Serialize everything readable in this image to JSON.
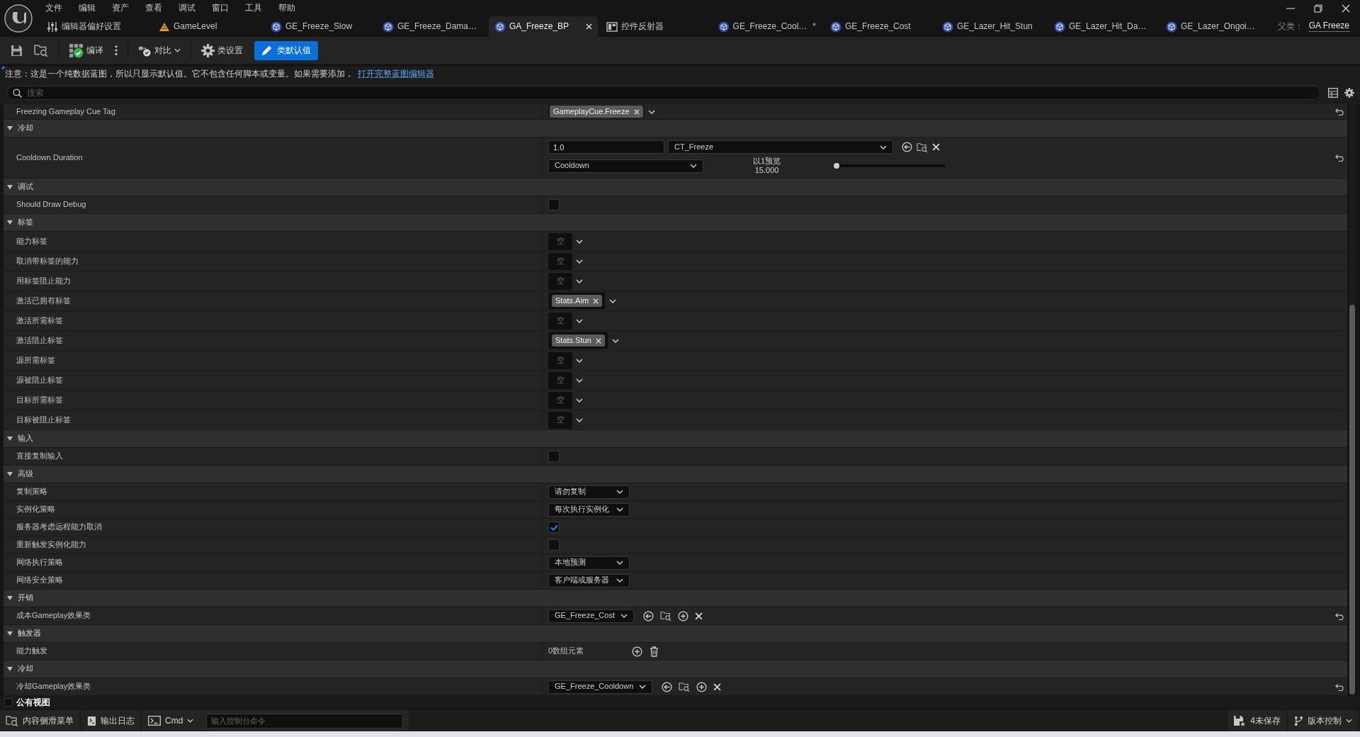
{
  "menu": [
    "文件",
    "编辑",
    "资产",
    "查看",
    "调试",
    "窗口",
    "工具",
    "帮助"
  ],
  "tabs": [
    {
      "kind": "settings",
      "label": "编辑器偏好设置",
      "selected": false
    },
    {
      "kind": "level",
      "label": "GameLevel",
      "selected": false
    },
    {
      "kind": "blueprint",
      "label": "GE_Freeze_Slow",
      "selected": false
    },
    {
      "kind": "blueprint",
      "label": "GE_Freeze_Dama…",
      "selected": false
    },
    {
      "kind": "blueprint",
      "label": "GA_Freeze_BP",
      "selected": true
    },
    {
      "kind": "widget",
      "label": "控件反射器",
      "selected": false
    },
    {
      "kind": "blueprint",
      "label": "GE_Freeze_Cool…",
      "dirty_mark": "*",
      "selected": false
    },
    {
      "kind": "blueprint",
      "label": "GE_Freeze_Cost",
      "selected": false
    },
    {
      "kind": "blueprint",
      "label": "GE_Lazer_Hit_Stun",
      "selected": false
    },
    {
      "kind": "blueprint",
      "label": "GE_Lazer_Hit_Da…",
      "selected": false
    },
    {
      "kind": "blueprint",
      "label": "GE_Lazer_Ongoi…",
      "selected": false
    }
  ],
  "parent_class": {
    "label": "父类：",
    "value": "GA Freeze"
  },
  "toolbar": {
    "groups": [
      {
        "items": [
          {
            "kind": "save"
          },
          {
            "kind": "browse"
          }
        ]
      },
      {
        "items": [
          {
            "kind": "compile",
            "label": "编译",
            "up_to_date": true
          },
          {
            "kind": "more"
          }
        ]
      },
      {
        "items": [
          {
            "kind": "diff",
            "label": "对比"
          }
        ]
      },
      {
        "items": [
          {
            "kind": "class_settings",
            "label": "类设置",
            "selected": false
          },
          {
            "kind": "class_defaults",
            "label": "类默认值",
            "selected": true
          }
        ]
      }
    ]
  },
  "notice": {
    "text": "注意：这是一个纯数据蓝图，所以只显示默认值。它不包含任何脚本或变量。如果需要添加，",
    "link": "打开完整蓝图编辑器"
  },
  "search": {
    "placeholder": "搜索"
  },
  "properties": [
    {
      "kind": "tags",
      "name": "Freezing Gameplay Cue Tag",
      "tags": [
        "GameplayCue.Freeze"
      ],
      "resettable": true
    },
    {
      "kind": "category",
      "name": "冷却",
      "expanded": true
    },
    {
      "kind": "scalable_float",
      "name": "Cooldown Duration",
      "value": "1.0",
      "curve_table": "CT_Freeze",
      "curve_row": "Cooldown",
      "preview_label": "以1预览",
      "preview_value": "15.000",
      "level": 0,
      "resettable": true
    },
    {
      "kind": "category",
      "name": "调试",
      "expanded": true
    },
    {
      "kind": "checkbox",
      "name": "Should Draw Debug",
      "checked": false
    },
    {
      "kind": "category",
      "name": "标签",
      "expanded": true
    },
    {
      "kind": "tags",
      "name": "能力标签",
      "empty_label": "空"
    },
    {
      "kind": "tags",
      "name": "取消带标签的能力",
      "empty_label": "空"
    },
    {
      "kind": "tags",
      "name": "用标签阻止能力",
      "empty_label": "空"
    },
    {
      "kind": "tags",
      "name": "激活已拥有标签",
      "tags": [
        "Stats.Aim"
      ]
    },
    {
      "kind": "tags",
      "name": "激活所需标签",
      "empty_label": "空"
    },
    {
      "kind": "tags",
      "name": "激活阻止标签",
      "tags": [
        "Stats.Stun"
      ]
    },
    {
      "kind": "tags",
      "name": "源所需标签",
      "empty_label": "空"
    },
    {
      "kind": "tags",
      "name": "源被阻止标签",
      "empty_label": "空"
    },
    {
      "kind": "tags",
      "name": "目标所需标签",
      "empty_label": "空"
    },
    {
      "kind": "tags",
      "name": "目标被阻止标签",
      "empty_label": "空"
    },
    {
      "kind": "category",
      "name": "输入",
      "expanded": true
    },
    {
      "kind": "checkbox",
      "name": "直接复制输入",
      "checked": false
    },
    {
      "kind": "category",
      "name": "高级",
      "expanded": true
    },
    {
      "kind": "dropdown",
      "name": "复制策略",
      "value": "请勿复制"
    },
    {
      "kind": "dropdown",
      "name": "实例化策略",
      "value": "每次执行实例化"
    },
    {
      "kind": "checkbox",
      "name": "服务器考虑远程能力取消",
      "checked": true
    },
    {
      "kind": "checkbox",
      "name": "重新触发实例化能力",
      "checked": false
    },
    {
      "kind": "dropdown",
      "name": "网络执行策略",
      "value": "本地预测"
    },
    {
      "kind": "dropdown",
      "name": "网络安全策略",
      "value": "客户端或服务器"
    },
    {
      "kind": "category",
      "name": "开销",
      "expanded": true
    },
    {
      "kind": "class",
      "name": "成本Gameplay效果类",
      "value": "GE_Freeze_Cost",
      "resettable": true
    },
    {
      "kind": "category",
      "name": "触发器",
      "expanded": true
    },
    {
      "kind": "array",
      "name": "能力触发",
      "value": "0数组元素"
    },
    {
      "kind": "category",
      "name": "冷却",
      "expanded": true
    },
    {
      "kind": "class",
      "name": "冷却Gameplay效果类",
      "value": "GE_Freeze_Cooldown",
      "resettable": true
    }
  ],
  "public_view": {
    "label": "公有视图",
    "checked": false
  },
  "status_bar": {
    "left": [
      {
        "kind": "content_drawer",
        "label": "内容侧滑菜单"
      },
      {
        "kind": "output_log",
        "label": "输出日志"
      },
      {
        "kind": "cmd",
        "label": "Cmd"
      }
    ],
    "console": {
      "placeholder": "输入控制台命令"
    },
    "right": [
      {
        "kind": "unsaved",
        "label": "4未保存"
      },
      {
        "kind": "source_control",
        "label": "版本控制"
      }
    ]
  }
}
